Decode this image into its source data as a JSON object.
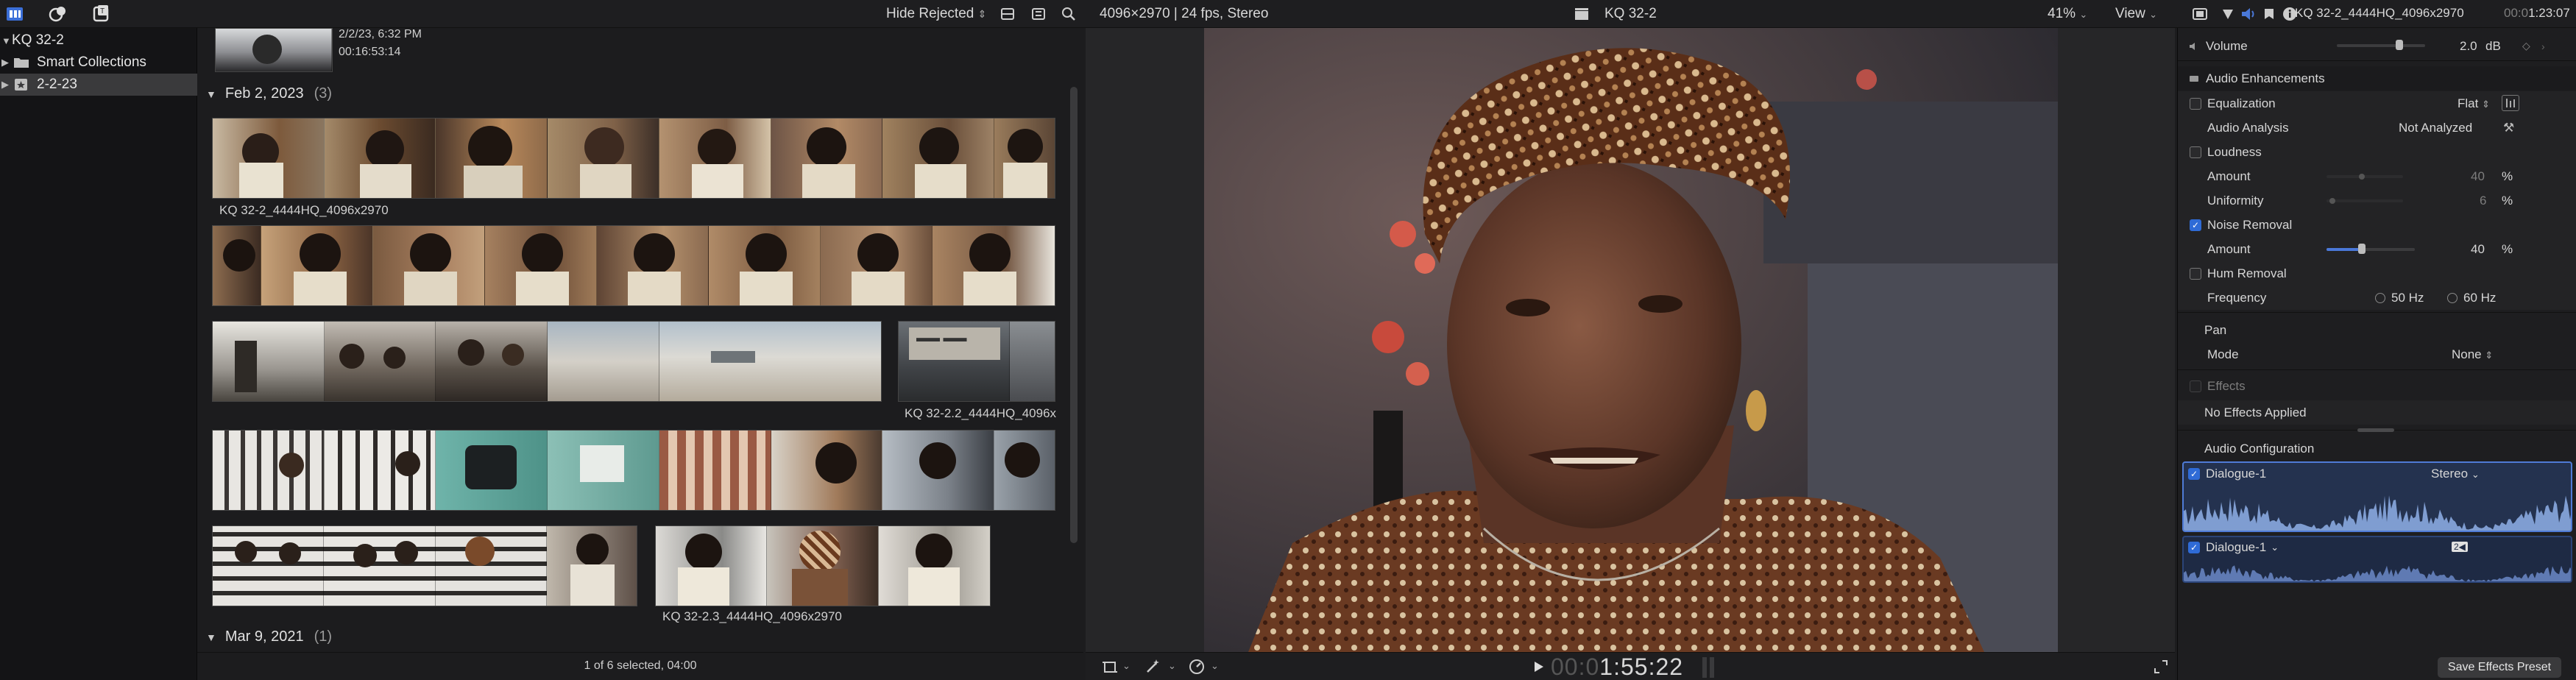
{
  "topbar": {
    "hide_rejected": "Hide Rejected",
    "format": "4096×2970 | 24 fps, Stereo",
    "clip_name": "KQ 32-2",
    "zoom": "41%",
    "view": "View",
    "inspector_title": "KQ 32-2_4444HQ_4096x2970",
    "inspector_tc_dim": "00:0",
    "inspector_tc": "1:23:07"
  },
  "sidebar": {
    "library": "KQ 32-2",
    "items": [
      {
        "label": "Smart Collections"
      },
      {
        "label": "2-2-23"
      }
    ]
  },
  "browser": {
    "top_clip": {
      "date": "2/2/23, 6:32 PM",
      "duration": "00:16:53:14"
    },
    "sections": [
      {
        "label": "Feb 2, 2023",
        "count": "(3)"
      },
      {
        "label": "Mar 9, 2021",
        "count": "(1)"
      }
    ],
    "clips": [
      {
        "name": "KQ 32-2_4444HQ_4096x2970"
      },
      {
        "name": "KQ 32-2.2_4444HQ_4096x"
      },
      {
        "name": "KQ 32-2.3_4444HQ_4096x2970"
      }
    ],
    "footer_status": "1 of 6 selected, 04:00"
  },
  "viewer": {
    "timecode_dim": "00:0",
    "timecode": "1:55:22"
  },
  "inspector": {
    "volume": {
      "label": "Volume",
      "value": "2.0",
      "unit": "dB"
    },
    "enhancements_header": "Audio Enhancements",
    "equalization": {
      "label": "Equalization",
      "value": "Flat"
    },
    "analysis": {
      "label": "Audio Analysis",
      "value": "Not Analyzed"
    },
    "loudness": {
      "label": "Loudness"
    },
    "loud_amount": {
      "label": "Amount",
      "value": "40",
      "unit": "%"
    },
    "loud_uniformity": {
      "label": "Uniformity",
      "value": "6",
      "unit": "%"
    },
    "noise_removal": {
      "label": "Noise Removal"
    },
    "noise_amount": {
      "label": "Amount",
      "value": "40",
      "unit": "%",
      "level_pct": 40
    },
    "hum_removal": {
      "label": "Hum Removal"
    },
    "frequency": {
      "label": "Frequency",
      "opt1": "50",
      "opt2": "60",
      "unit": "Hz"
    },
    "pan_header": "Pan",
    "pan_mode": {
      "label": "Mode",
      "value": "None"
    },
    "effects_header": "Effects",
    "no_effects": "No Effects Applied",
    "audio_config": "Audio Configuration",
    "component1": {
      "label": "Dialogue-1",
      "channel": "Stereo"
    },
    "component2": {
      "label": "Dialogue-1",
      "badge": "2◀"
    },
    "save_preset": "Save Effects Preset"
  },
  "colors": {
    "accent": "#2f6bd6",
    "waveform": "#8fb0e8"
  }
}
